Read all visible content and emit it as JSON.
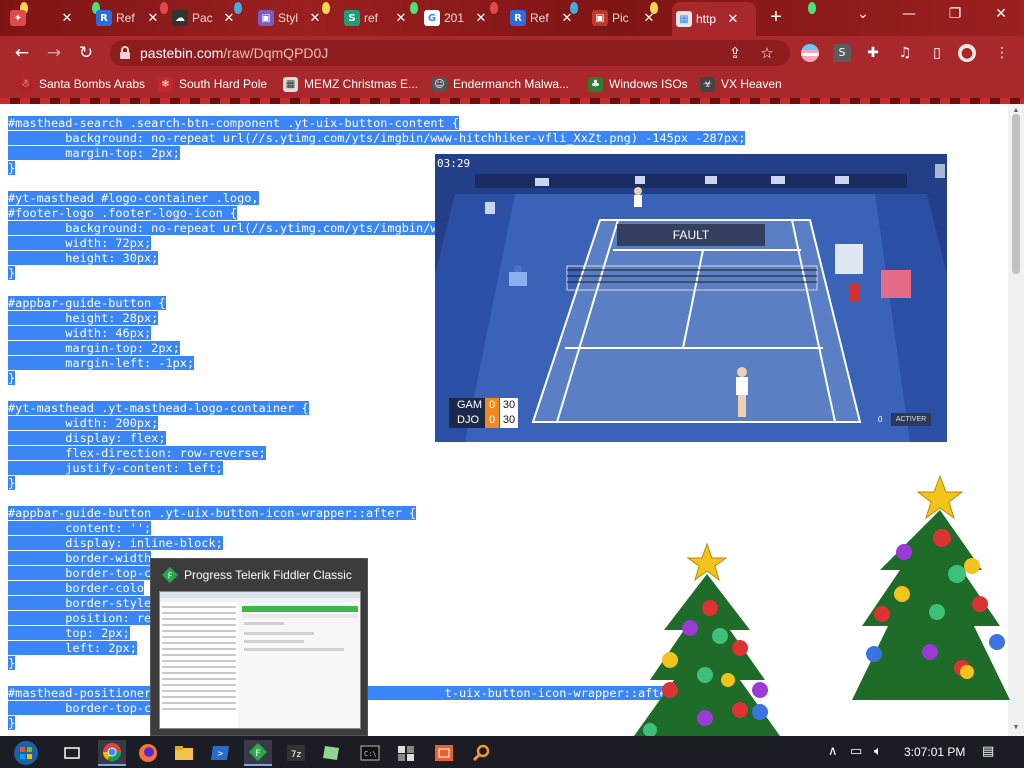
{
  "browser": {
    "tabs": [
      {
        "title": "",
        "favicon": "xmas-tab-icon",
        "color": "#e04a4a",
        "glyph": "✦"
      },
      {
        "title": "Ref",
        "favicon": "letter-r-icon",
        "color": "#2d6cdf",
        "glyph": "R"
      },
      {
        "title": "Pac",
        "favicon": "cloud-icon",
        "color": "#333333",
        "glyph": "☁"
      },
      {
        "title": "Styl",
        "favicon": "picture-icon",
        "color": "#7a5cc7",
        "glyph": "▣"
      },
      {
        "title": "ref",
        "favicon": "s-icon",
        "color": "#1e9e7a",
        "glyph": "S"
      },
      {
        "title": "201",
        "favicon": "google-icon",
        "color": "#ffffff",
        "glyph": "G"
      },
      {
        "title": "Ref",
        "favicon": "letter-r-icon",
        "color": "#2d6cdf",
        "glyph": "R"
      },
      {
        "title": "Pic",
        "favicon": "picture-icon",
        "color": "#c0392b",
        "glyph": "▣"
      },
      {
        "title": "http",
        "favicon": "grid-icon",
        "color": "#e6e6e6",
        "glyph": "▦",
        "active": true
      }
    ],
    "address": {
      "host": "pastebin.com",
      "path": "/raw/DqmQPD0J"
    },
    "bookmarks": [
      {
        "label": "Santa Bombs Arabs",
        "icon": "santa-icon",
        "color": "#b22222",
        "glyph": "☃"
      },
      {
        "label": "South Hard Pole",
        "icon": "snowflake-icon",
        "color": "#c62828",
        "glyph": "❄"
      },
      {
        "label": "MEMZ Christmas E...",
        "icon": "memz-icon",
        "color": "#dddddd",
        "glyph": "▦"
      },
      {
        "label": "Endermanch Malwa...",
        "icon": "cat-icon",
        "color": "#555555",
        "glyph": "☺"
      },
      {
        "label": "Windows ISOs",
        "icon": "tree-icon",
        "color": "#2e7d32",
        "glyph": "♣"
      },
      {
        "label": "VX Heaven",
        "icon": "biohazard-icon",
        "color": "#444444",
        "glyph": "☣"
      }
    ]
  },
  "code_lines": [
    "#masthead-search .search-btn-component .yt-uix-button-content {",
    "        background: no-repeat url(//s.ytimg.com/yts/imgbin/www-hitchhiker-vfli_XxZt.png) -145px -287px;",
    "        margin-top: 2px;",
    "}",
    "",
    "#yt-masthead #logo-container .logo,",
    "#footer-logo .footer-logo-icon {",
    "        background: no-repeat url(//s.ytimg.com/yts/imgbin/w",
    "        width: 72px;",
    "        height: 30px;",
    "}",
    "",
    "#appbar-guide-button {",
    "        height: 28px;",
    "        width: 46px;",
    "        margin-top: 2px;",
    "        margin-left: -1px;",
    "}",
    "",
    "#yt-masthead .yt-masthead-logo-container {",
    "        width: 200px;",
    "        display: flex;",
    "        flex-direction: row-reverse;",
    "        justify-content: left;",
    "}",
    "",
    "#appbar-guide-button .yt-uix-button-icon-wrapper::after {",
    "        content: '';",
    "        display: inline-block;",
    "        border-width",
    "        border-top-c",
    "        border-colo",
    "        border-style",
    "        position: re",
    "        top: 2px;",
    "        left: 2px;",
    "}",
    "",
    "#masthead-positioner                                         t-uix-button-icon-wrapper::after {",
    "        border-top-c",
    "}"
  ],
  "game": {
    "clock": "03:29",
    "banner": "FAULT",
    "players": [
      {
        "name": "GAM",
        "sets": "0",
        "points": "30"
      },
      {
        "name": "DJO",
        "sets": "0",
        "points": "30"
      }
    ],
    "side_points": "0",
    "status": "ACTIVER"
  },
  "thumbnail": {
    "title": "Progress Telerik Fiddler Classic"
  },
  "taskbar": {
    "apps": [
      "start-orb-icon",
      "task-view-icon",
      "chrome-icon",
      "firefox-icon",
      "file-explorer-icon",
      "powershell-icon",
      "fiddler-icon",
      "7zip-icon",
      "notepadpp-icon",
      "cmd-icon",
      "puzzle-app-icon",
      "reg-app-icon",
      "search-app-icon"
    ],
    "time": "3:07:01 PM"
  }
}
